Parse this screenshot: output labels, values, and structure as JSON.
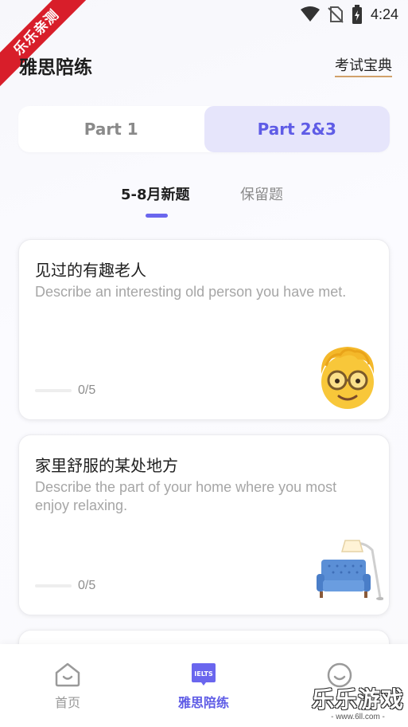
{
  "status_bar": {
    "time": "4:24"
  },
  "watermark": {
    "ribbon_text": "乐乐亲测",
    "brand_text": "乐乐游戏",
    "brand_url": "- www.6ll.com -"
  },
  "header": {
    "title": "雅思陪练",
    "link_label": "考试宝典"
  },
  "part_tabs": [
    {
      "label": "Part 1",
      "active": false
    },
    {
      "label": "Part 2&3",
      "active": true
    }
  ],
  "sub_tabs": [
    {
      "label": "5-8月新题",
      "active": true
    },
    {
      "label": "保留题",
      "active": false
    }
  ],
  "cards": [
    {
      "title": "见过的有趣老人",
      "description": "Describe an interesting old person you have met.",
      "progress_text": "0/5",
      "progress": 0,
      "icon": "old-person-emoji"
    },
    {
      "title": "家里舒服的某处地方",
      "description": "Describe the part of your home where you most enjoy relaxing.",
      "progress_text": "0/5",
      "progress": 0,
      "icon": "sofa-lamp-illustration"
    }
  ],
  "bottom_nav": [
    {
      "label": "首页",
      "icon": "home-icon",
      "active": false
    },
    {
      "label": "雅思陪练",
      "icon": "ielts-icon",
      "icon_text": "IELTS",
      "active": true
    },
    {
      "label": "",
      "icon": "profile-icon",
      "active": false
    }
  ],
  "colors": {
    "accent": "#5f5ce6",
    "accent_light": "#e6e5fb",
    "ribbon": "#d81e2a"
  }
}
